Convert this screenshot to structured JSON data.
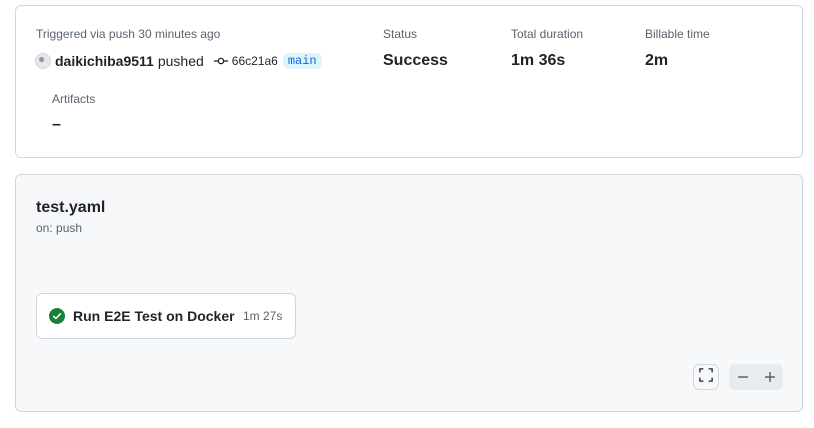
{
  "summary": {
    "trigger_label": "Triggered via push 30 minutes ago",
    "actor": "daikichiba9511",
    "action": "pushed",
    "commit_sha": "66c21a6",
    "branch": "main",
    "status_label": "Status",
    "status_value": "Success",
    "duration_label": "Total duration",
    "duration_value": "1m 36s",
    "billable_label": "Billable time",
    "billable_value": "2m",
    "artifacts_label": "Artifacts",
    "artifacts_value": "–"
  },
  "workflow": {
    "name": "test.yaml",
    "trigger": "on: push",
    "jobs": [
      {
        "name": "Run E2E Test on Docker",
        "duration": "1m 27s",
        "status": "success"
      }
    ]
  },
  "colors": {
    "success": "#1a7f37",
    "branch_text": "#0969da",
    "branch_bg": "#ddf4ff",
    "border": "#d0d7de",
    "graph_bg": "#f6f8fa"
  },
  "icons": [
    "avatar",
    "git-commit-icon",
    "check-circle-icon",
    "fullscreen-icon",
    "zoom-out-icon",
    "zoom-in-icon"
  ]
}
